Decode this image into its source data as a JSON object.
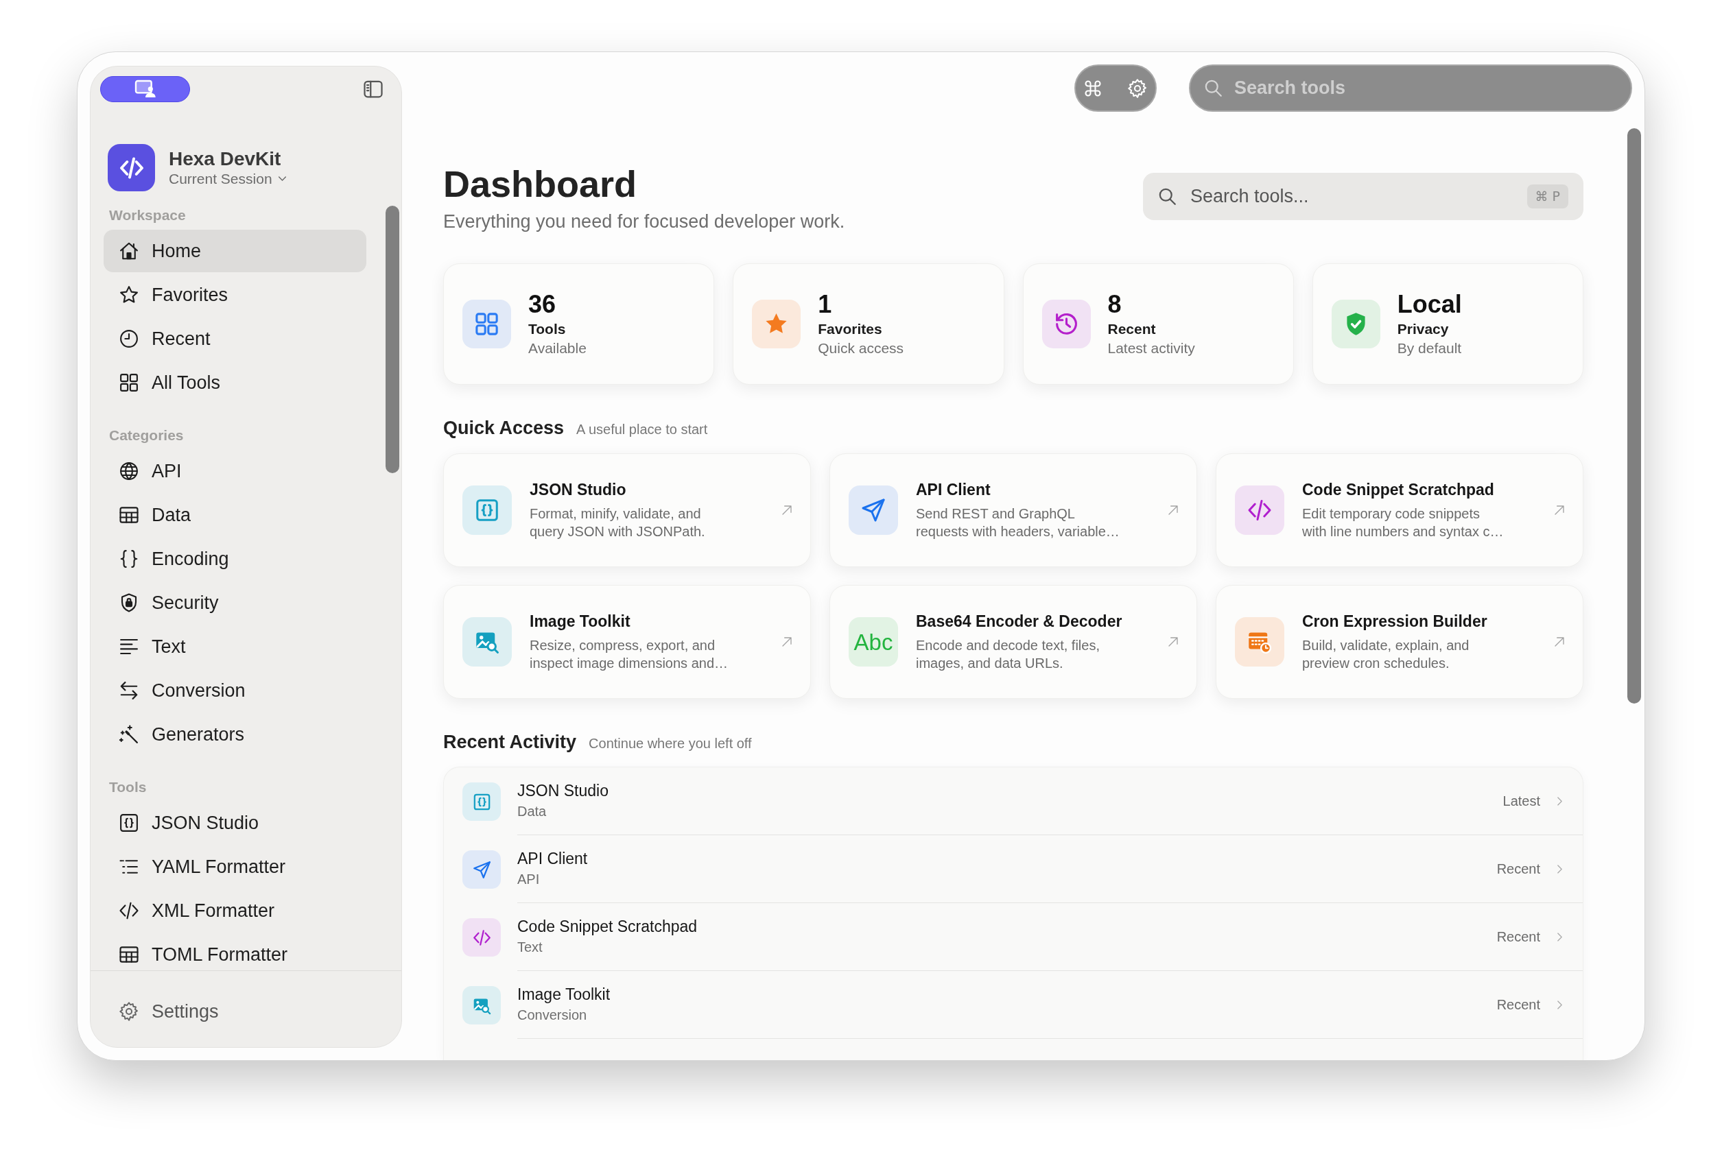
{
  "sidebar": {
    "app": {
      "name": "Hexa DevKit",
      "session": "Current Session"
    },
    "sections": [
      {
        "title": "Workspace",
        "items": [
          {
            "label": "Home",
            "selected": true
          },
          {
            "label": "Favorites",
            "selected": false
          },
          {
            "label": "Recent",
            "selected": false
          },
          {
            "label": "All Tools",
            "selected": false
          }
        ]
      },
      {
        "title": "Categories",
        "items": [
          {
            "label": "API",
            "selected": false
          },
          {
            "label": "Data",
            "selected": false
          },
          {
            "label": "Encoding",
            "selected": false
          },
          {
            "label": "Security",
            "selected": false
          },
          {
            "label": "Text",
            "selected": false
          },
          {
            "label": "Conversion",
            "selected": false
          },
          {
            "label": "Generators",
            "selected": false
          }
        ]
      },
      {
        "title": "Tools",
        "items": [
          {
            "label": "JSON Studio",
            "selected": false
          },
          {
            "label": "YAML Formatter",
            "selected": false
          },
          {
            "label": "XML Formatter",
            "selected": false
          },
          {
            "label": "TOML Formatter",
            "selected": false
          }
        ]
      }
    ],
    "footer": {
      "label": "Settings"
    }
  },
  "toolbar": {
    "search": {
      "placeholder": "Search tools"
    }
  },
  "header": {
    "title": "Dashboard",
    "subtitle": "Everything you need for focused developer work.",
    "search": {
      "placeholder": "Search tools...",
      "shortcut": "⌘ P"
    }
  },
  "stats": [
    {
      "value": "36",
      "label": "Tools",
      "caption": "Available"
    },
    {
      "value": "1",
      "label": "Favorites",
      "caption": "Quick access"
    },
    {
      "value": "8",
      "label": "Recent",
      "caption": "Latest activity"
    },
    {
      "value": "Local",
      "label": "Privacy",
      "caption": "By default"
    }
  ],
  "quick_access": {
    "title": "Quick Access",
    "subtitle": "A useful place to start",
    "tools": [
      {
        "title": "JSON Studio",
        "description_lines": [
          "Format, minify, validate, and",
          "query JSON with JSONPath."
        ]
      },
      {
        "title": "API Client",
        "description_lines": [
          "Send REST and GraphQL",
          "requests with headers, variable…"
        ]
      },
      {
        "title": "Code Snippet Scratchpad",
        "description_lines": [
          "Edit temporary code snippets",
          "with line numbers and syntax c…"
        ]
      },
      {
        "title": "Image Toolkit",
        "description_lines": [
          "Resize, compress, export, and",
          "inspect image dimensions and…"
        ]
      },
      {
        "title": "Base64 Encoder & Decoder",
        "icon_text": "Abc",
        "description_lines": [
          "Encode and decode text, files,",
          "images, and data URLs."
        ]
      },
      {
        "title": "Cron Expression Builder",
        "description_lines": [
          "Build, validate, explain, and",
          "preview cron schedules."
        ]
      }
    ]
  },
  "recent_activity": {
    "title": "Recent Activity",
    "subtitle": "Continue where you left off",
    "items": [
      {
        "title": "JSON Studio",
        "category": "Data",
        "when": "Latest"
      },
      {
        "title": "API Client",
        "category": "API",
        "when": "Recent"
      },
      {
        "title": "Code Snippet Scratchpad",
        "category": "Text",
        "when": "Recent"
      },
      {
        "title": "Image Toolkit",
        "category": "Conversion",
        "when": "Recent"
      }
    ]
  }
}
